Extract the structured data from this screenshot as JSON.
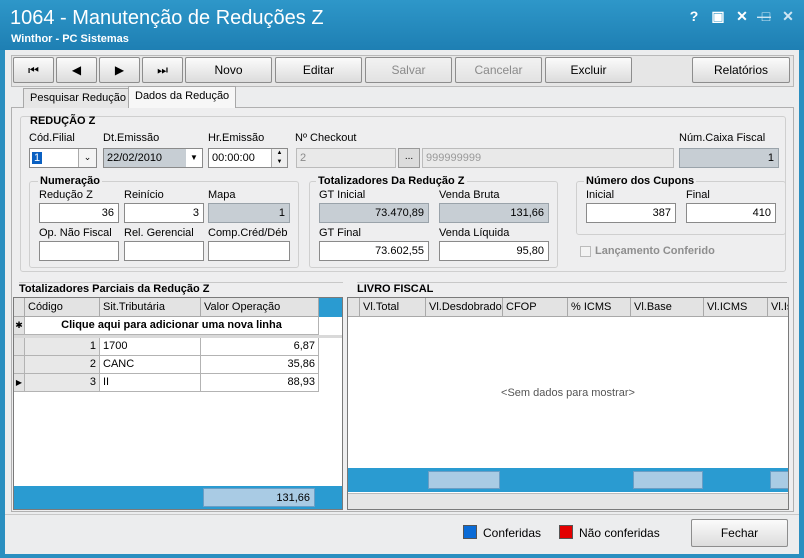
{
  "window": {
    "title": "1064 - Manutenção de Reduções Z",
    "subtitle": "Winthor - PC Sistemas",
    "help_glyph": "?",
    "restore_glyph": "▣",
    "close_glyph": "✕",
    "min_glyph": "—",
    "max_glyph": "□",
    "close2_glyph": "✕"
  },
  "toolbar": {
    "first": "⏮",
    "prev": "◀",
    "next": "▶",
    "last": "⏭",
    "novo": "Novo",
    "editar": "Editar",
    "salvar": "Salvar",
    "cancelar": "Cancelar",
    "excluir": "Excluir",
    "relatorios": "Relatórios"
  },
  "tabs": {
    "pesquisar": "Pesquisar Redução",
    "dados": "Dados da Redução"
  },
  "reducao": {
    "section": "REDUÇÃO Z",
    "cod_filial_label": "Cód.Filial",
    "cod_filial_value": "1",
    "dt_emissao_label": "Dt.Emissão",
    "dt_emissao_value": "22/02/2010",
    "hr_emissao_label": "Hr.Emissão",
    "hr_emissao_value": "00:00:00",
    "checkout_label": "Nº Checkout",
    "checkout_value": "2",
    "checkout_btn": "...",
    "checkout_desc": "999999999",
    "num_caixa_label": "Núm.Caixa Fiscal",
    "num_caixa_value": "1"
  },
  "numeracao": {
    "title": "Numeração",
    "reducao_z_label": "Redução Z",
    "reducao_z_value": "36",
    "reinicio_label": "Reinício",
    "reinicio_value": "3",
    "mapa_label": "Mapa",
    "mapa_value": "1",
    "op_nao_fiscal_label": "Op. Não Fiscal",
    "rel_gerencial_label": "Rel. Gerencial",
    "comp_cred_label": "Comp.Créd/Déb"
  },
  "totalizadores": {
    "title": "Totalizadores Da Redução Z",
    "gt_inicial_label": "GT Inicial",
    "gt_inicial_value": "73.470,89",
    "venda_bruta_label": "Venda Bruta",
    "venda_bruta_value": "131,66",
    "gt_final_label": "GT Final",
    "gt_final_value": "73.602,55",
    "venda_liquida_label": "Venda Líquida",
    "venda_liquida_value": "95,80"
  },
  "cupons": {
    "title": "Número dos Cupons",
    "inicial_label": "Inicial",
    "inicial_value": "387",
    "final_label": "Final",
    "final_value": "410",
    "lancamento": "Lançamento Conferido"
  },
  "parciais": {
    "title": "Totalizadores Parciais da Redução Z",
    "columns": [
      "Código",
      "Sit.Tributária",
      "Valor Operação"
    ],
    "new_row": "Clique aqui para adicionar uma nova linha",
    "rows": [
      {
        "code": "1",
        "sit": "1700",
        "valor": "6,87"
      },
      {
        "code": "2",
        "sit": "CANC",
        "valor": "35,86"
      },
      {
        "code": "3",
        "sit": "II",
        "valor": "88,93"
      }
    ],
    "total": "131,66"
  },
  "livro": {
    "title": "LIVRO FISCAL",
    "columns": [
      "Vl.Total",
      "Vl.Desdobrado",
      "CFOP",
      "% ICMS",
      "Vl.Base",
      "Vl.ICMS",
      "Vl.Is"
    ],
    "empty": "<Sem dados para mostrar>"
  },
  "status": {
    "conferidas": "Conferidas",
    "nao_conferidas": "Não conferidas",
    "fechar": "Fechar",
    "color_conferidas": "#0a6bd6",
    "color_nao": "#e30000"
  }
}
